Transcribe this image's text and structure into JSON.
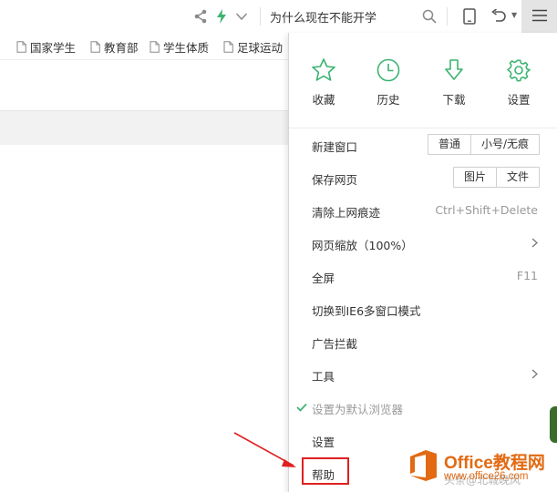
{
  "toolbar": {
    "search_value": "为什么现在不能开学",
    "icons": [
      "share-icon",
      "bolt-icon",
      "chevron-down-icon",
      "search-icon",
      "tablet-icon",
      "undo-icon",
      "menu-icon"
    ]
  },
  "bookmarks": [
    {
      "label": "国家学生",
      "icon": "page-icon"
    },
    {
      "label": "教育部",
      "icon": "page-icon"
    },
    {
      "label": "学生体质",
      "icon": "page-icon"
    },
    {
      "label": "足球运动",
      "icon": "page-icon"
    }
  ],
  "menu": {
    "quick_actions": [
      {
        "label": "收藏",
        "icon": "star-icon"
      },
      {
        "label": "历史",
        "icon": "clock-icon"
      },
      {
        "label": "下载",
        "icon": "download-icon"
      },
      {
        "label": "设置",
        "icon": "gear-icon"
      }
    ],
    "items": [
      {
        "label": "新建窗口",
        "buttons": [
          "普通",
          "小号/无痕"
        ]
      },
      {
        "label": "保存网页",
        "buttons": [
          "图片",
          "文件"
        ]
      },
      {
        "label": "清除上网痕迹",
        "shortcut": "Ctrl+Shift+Delete"
      },
      {
        "label": "网页缩放（100%）",
        "submenu": true
      },
      {
        "label": "全屏",
        "shortcut": "F11"
      },
      {
        "label": "切换到IE6多窗口模式"
      },
      {
        "label": "广告拦截"
      },
      {
        "label": "工具",
        "submenu": true
      },
      {
        "label": "设置为默认浏览器",
        "checked": true,
        "disabled": true
      },
      {
        "label": "设置"
      },
      {
        "label": "帮助",
        "highlighted": true
      }
    ]
  },
  "annotation": {
    "color": "#e02020"
  },
  "watermark": {
    "title": "Office教程网",
    "url": "www.office26.com",
    "faint": "头条@北城晚风"
  },
  "colors": {
    "accent_green": "#3cb371",
    "menu_button_bg": "#e4e4e4",
    "highlight_red": "#e02020",
    "watermark_orange": "#e26a12"
  }
}
